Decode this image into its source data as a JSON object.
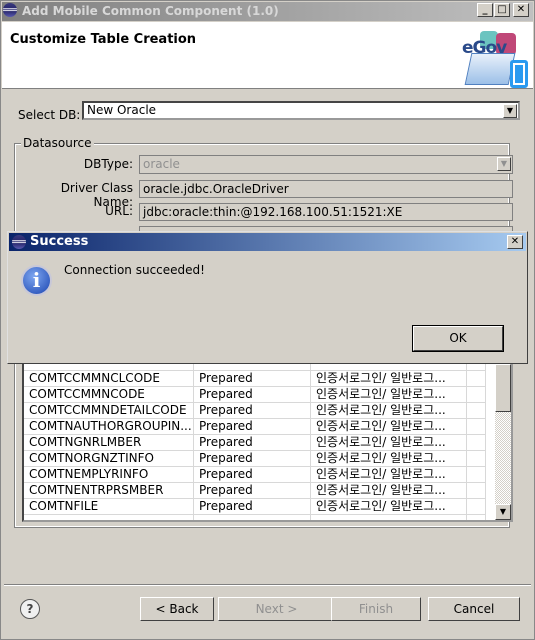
{
  "window": {
    "title": "Add Mobile Common Component (1.0)",
    "minimize": "_",
    "maximize": "□",
    "close": "✕"
  },
  "header": {
    "title": "Customize Table Creation",
    "logo_text": "eGov"
  },
  "select_db": {
    "label": "Select DB:",
    "value": "New Oracle"
  },
  "datasource": {
    "legend": "Datasource",
    "dbtype": {
      "label": "DBType:",
      "value": "oracle"
    },
    "driver": {
      "label": "Driver Class Name:",
      "value": "oracle.jdbc.OracleDriver"
    },
    "url": {
      "label": "URL:",
      "value": "jdbc:oracle:thin:@192.168.100.51:1521:XE"
    }
  },
  "table": {
    "rows": [
      {
        "name": "COMTCCMMNCLCODE",
        "status": "Prepared",
        "desc": "인증서로그인/ 일반로그..."
      },
      {
        "name": "COMTCCMMNCODE",
        "status": "Prepared",
        "desc": "인증서로그인/ 일반로그..."
      },
      {
        "name": "COMTCCMMNDETAILCODE",
        "status": "Prepared",
        "desc": "인증서로그인/ 일반로그..."
      },
      {
        "name": "COMTNAUTHORGROUPIN...",
        "status": "Prepared",
        "desc": "인증서로그인/ 일반로그..."
      },
      {
        "name": "COMTNGNRLMBER",
        "status": "Prepared",
        "desc": "인증서로그인/ 일반로그..."
      },
      {
        "name": "COMTNORGNZTINFO",
        "status": "Prepared",
        "desc": "인증서로그인/ 일반로그..."
      },
      {
        "name": "COMTNEMPLYRINFO",
        "status": "Prepared",
        "desc": "인증서로그인/ 일반로그..."
      },
      {
        "name": "COMTNENTRPRSMBER",
        "status": "Prepared",
        "desc": "인증서로그인/ 일반로그..."
      },
      {
        "name": "COMTNFILE",
        "status": "Prepared",
        "desc": "인증서로그인/ 일반로그..."
      }
    ]
  },
  "dialog": {
    "title": "Success",
    "message": "Connection succeeded!",
    "ok": "OK",
    "close": "✕"
  },
  "footer": {
    "help": "?",
    "back": "< Back",
    "next": "Next >",
    "finish": "Finish",
    "cancel": "Cancel"
  }
}
